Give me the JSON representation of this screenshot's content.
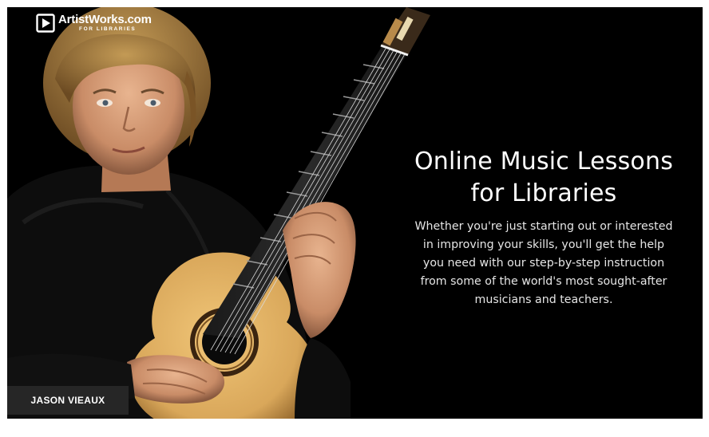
{
  "brand": {
    "name": "ArtistWorks.com",
    "subtitle": "FOR LIBRARIES"
  },
  "hero": {
    "headline_line1": "Online Music Lessons",
    "headline_line2": "for Libraries",
    "body_line1": "Whether you're just starting out or interested",
    "body_line2": "in improving your skills, you'll get the help",
    "body_line3": "you need with our step-by-step instruction",
    "body_line4": "from some of the world's most sought-after",
    "body_line5": "musicians and teachers."
  },
  "artist": {
    "caption": "JASON VIEAUX"
  },
  "colors": {
    "background": "#000000",
    "text": "#ffffff",
    "caption_bg": "#262626",
    "guitar_top": "#d9a75a"
  },
  "icons": {
    "logo": "play-screen-icon"
  }
}
